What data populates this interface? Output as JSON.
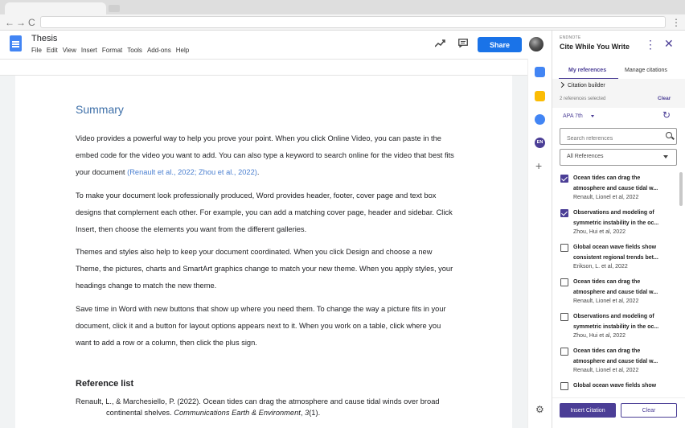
{
  "browser": {
    "back": "←",
    "forward": "→",
    "reload": "C",
    "menu": "⋮"
  },
  "doc": {
    "title": "Thesis",
    "menu": [
      "File",
      "Edit",
      "View",
      "Insert",
      "Format",
      "Tools",
      "Add-ons",
      "Help"
    ],
    "share_label": "Share"
  },
  "content": {
    "heading": "Summary",
    "p1_text": "Video provides a powerful way to help you prove your point. When you click Online Video, you can paste in the embed code for the video you want to add. You can also type a keyword to search online for the video that best fits your document ",
    "p1_cite": "(Renault et al., 2022; Zhou et al., 2022)",
    "p1_end": ".",
    "p2": "To make your document look professionally produced, Word provides header, footer, cover page and text box designs that complement each other. For example, you can add a matching cover page, header and sidebar. Click Insert, then choose the elements you want from the different galleries.",
    "p3": "Themes and styles also help to keep your document coordinated. When you click Design and choose a new Theme, the pictures, charts and SmartArt graphics change to match your new theme. When you apply styles, your headings change to match the new theme.",
    "p4": "Save time in Word with new buttons that show up where you need them. To change the way a picture fits in your document, click it and a button for layout options appears next to it. When you work on a table, click where you want to add a row or a column, then click the plus sign.",
    "ref_heading": "Reference list",
    "ref1_main": "Renault, L., & Marchesiello, P. (2022). Ocean tides can drag the atmosphere and cause tidal winds over broad continental shelves. ",
    "ref1_journal": "Communications Earth & Environment",
    "ref1_sep": ", ",
    "ref1_volume": "3",
    "ref1_issue": "(1)."
  },
  "panel": {
    "brand": "ENDNOTE",
    "title": "Cite While You Write",
    "kebab": "⋮",
    "close": "✕",
    "tabs": [
      "My references",
      "Manage citations"
    ],
    "citation_builder": "Citation builder",
    "selected_count": "2 references selected",
    "clear_link": "Clear",
    "style": "APA 7th",
    "refresh": "↻",
    "search_placeholder": "Search references",
    "filter_value": "All References",
    "references": [
      {
        "title": "Ocean tides can drag the atmosphere and cause tidal w...",
        "author": "Renault, Lionel et al, 2022",
        "checked": true
      },
      {
        "title": "Observations and modeling of symmetric instability in the oc...",
        "author": "Zhou, Hui et al, 2022",
        "checked": true
      },
      {
        "title": "Global ocean wave fields show consistent regional trends bet...",
        "author": "Erikson, L. et al, 2022",
        "checked": false
      },
      {
        "title": "Ocean tides can drag the atmosphere and cause tidal w...",
        "author": "Renault, Lionel et al, 2022",
        "checked": false
      },
      {
        "title": "Observations and modeling of symmetric instability in the oc...",
        "author": "Zhou, Hui et al, 2022",
        "checked": false
      },
      {
        "title": "Ocean tides can drag the atmosphere and cause tidal w...",
        "author": "Renault, Lionel et al, 2022",
        "checked": false
      },
      {
        "title": "Global ocean wave fields show consistent regional trends bet...",
        "author": "",
        "checked": false
      }
    ],
    "insert_label": "Insert Citation",
    "clear_label": "Clear"
  },
  "strip": {
    "en_label": "EN",
    "plus": "+",
    "gear": "⚙"
  },
  "colors": {
    "accent": "#4b3e96",
    "share": "#1a73e8",
    "cite": "#4a7fd0"
  }
}
